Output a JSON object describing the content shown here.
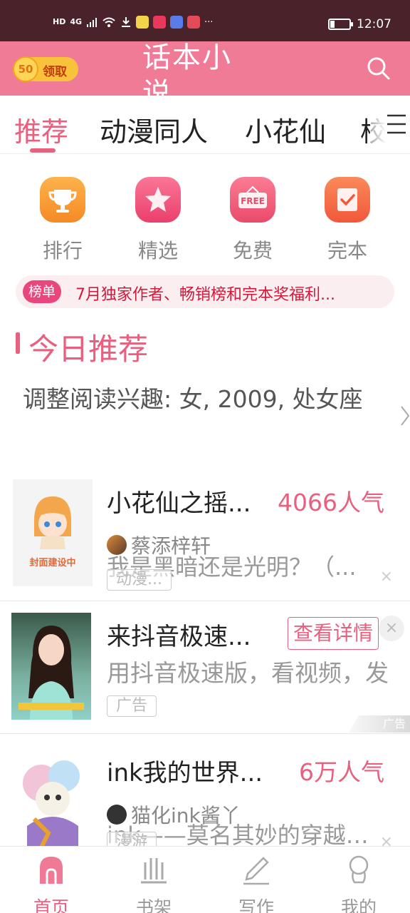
{
  "status_bar": {
    "left_badges": [
      "HD",
      "4G"
    ],
    "time": "12:07",
    "more": "···"
  },
  "header": {
    "coin_amount": "50",
    "coin_label": "领取",
    "title": "话本小说",
    "search_icon": "search-icon"
  },
  "tabs": [
    {
      "label": "推荐",
      "active": true
    },
    {
      "label": "动漫同人",
      "active": false
    },
    {
      "label": "小花仙",
      "active": false
    },
    {
      "label": "校园",
      "active": false
    }
  ],
  "categories": [
    {
      "label": "排行",
      "icon": "trophy-icon",
      "color": "#f9a23b"
    },
    {
      "label": "精选",
      "icon": "star-icon",
      "color": "#f2587d"
    },
    {
      "label": "免费",
      "icon": "free-sign-icon",
      "color": "#f0637a"
    },
    {
      "label": "完本",
      "icon": "check-book-icon",
      "color": "#f6774c"
    }
  ],
  "banner": {
    "badge": "榜单",
    "text": "7月独家作者、畅销榜和完本奖福利..."
  },
  "section": {
    "title": "今日推荐",
    "interest": "调整阅读兴趣: 女, 2009, 处女座"
  },
  "items": [
    {
      "title": "小花仙之摇...",
      "heat": "4066人气",
      "author": "蔡添梓轩",
      "desc": "我是黑暗还是光明？（...",
      "tag": "动漫...",
      "cover_text": "封面建设中",
      "close": "×"
    },
    {
      "title": "来抖音极速...",
      "button": "查看详情",
      "desc": "用抖音极速版，看视频，发",
      "tag": "广告",
      "ad_mark": "广告",
      "close": "×"
    },
    {
      "title": "ink我的世界...",
      "heat": "6万人气",
      "author": "猫化ink酱丫",
      "desc": "ink——莫名其妙的穿越了...",
      "tag": "漫游",
      "close": "×"
    }
  ],
  "bottom_nav": [
    {
      "label": "首页",
      "icon": "home-icon",
      "active": true
    },
    {
      "label": "书架",
      "icon": "bookshelf-icon",
      "active": false
    },
    {
      "label": "写作",
      "icon": "pen-icon",
      "active": false
    },
    {
      "label": "我的",
      "icon": "profile-icon",
      "active": false
    }
  ],
  "colors": {
    "accent": "#e9607f",
    "header_bg": "#ef7b97",
    "status_bar_bg": "#4a2229"
  }
}
